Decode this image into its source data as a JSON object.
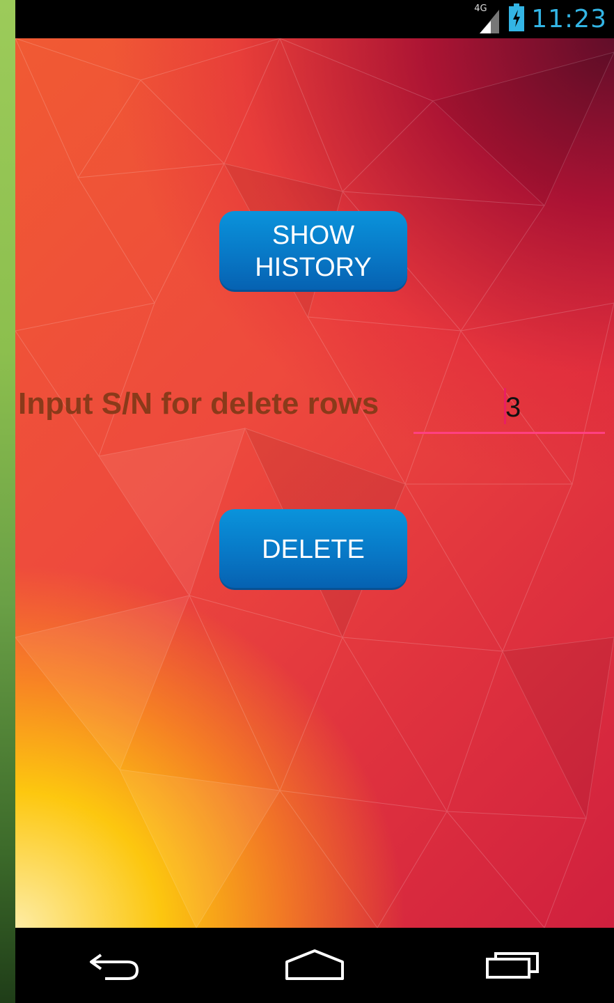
{
  "status_bar": {
    "network": "4G",
    "time": "11:23",
    "icons": [
      "signal-icon",
      "battery-charging-icon"
    ],
    "accent_color": "#33b5e5"
  },
  "main": {
    "show_history_label": "SHOW\nHISTORY",
    "delete_row_label": "Input S/N for delete rows",
    "sn_input_value": "3",
    "delete_label": "DELETE"
  },
  "nav_bar": {
    "icons": [
      "back-icon",
      "home-icon",
      "recent-apps-icon"
    ]
  },
  "colors": {
    "button": "#0878c6",
    "input_underline": "#ff4081",
    "label_text": "#8a3a1a"
  }
}
